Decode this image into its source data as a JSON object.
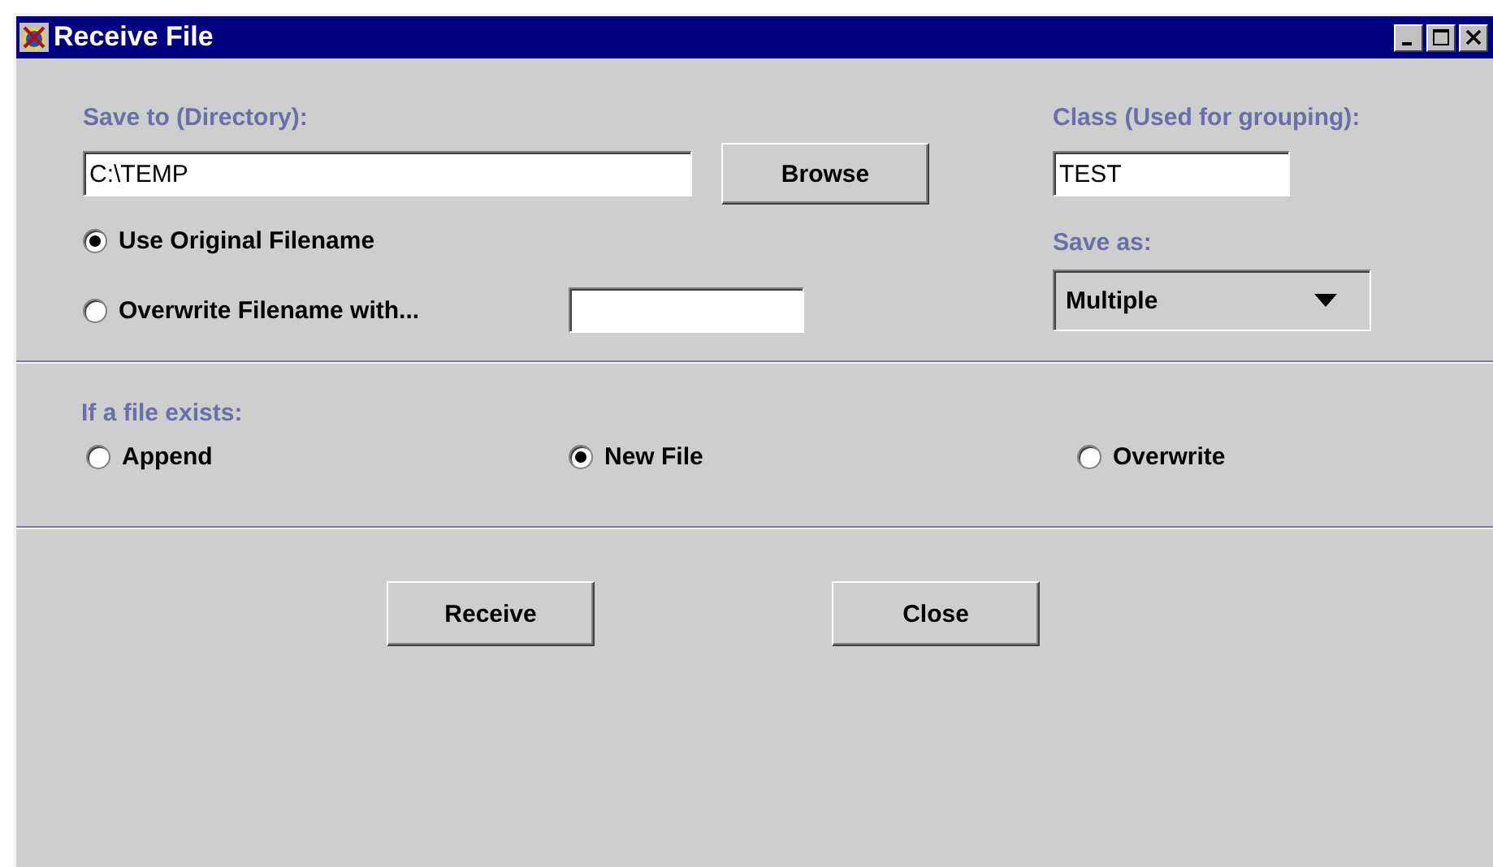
{
  "window": {
    "title": "Receive File"
  },
  "directory": {
    "label": "Save to (Directory):",
    "value": "C:\\TEMP"
  },
  "browse_button": "Browse",
  "class_field": {
    "label": "Class (Used for grouping):",
    "value": "TEST"
  },
  "filename_options": [
    {
      "label": "Use Original Filename",
      "selected": true
    },
    {
      "label": "Overwrite Filename with...",
      "selected": false
    }
  ],
  "save_as": {
    "label": "Save as:",
    "value": "Multiple"
  },
  "if_exists": {
    "label": "If a file exists:",
    "options": [
      {
        "label": "Append",
        "selected": false
      },
      {
        "label": "New File",
        "selected": true
      },
      {
        "label": "Overwrite",
        "selected": false
      }
    ]
  },
  "buttons": [
    "Receive",
    "Close"
  ]
}
